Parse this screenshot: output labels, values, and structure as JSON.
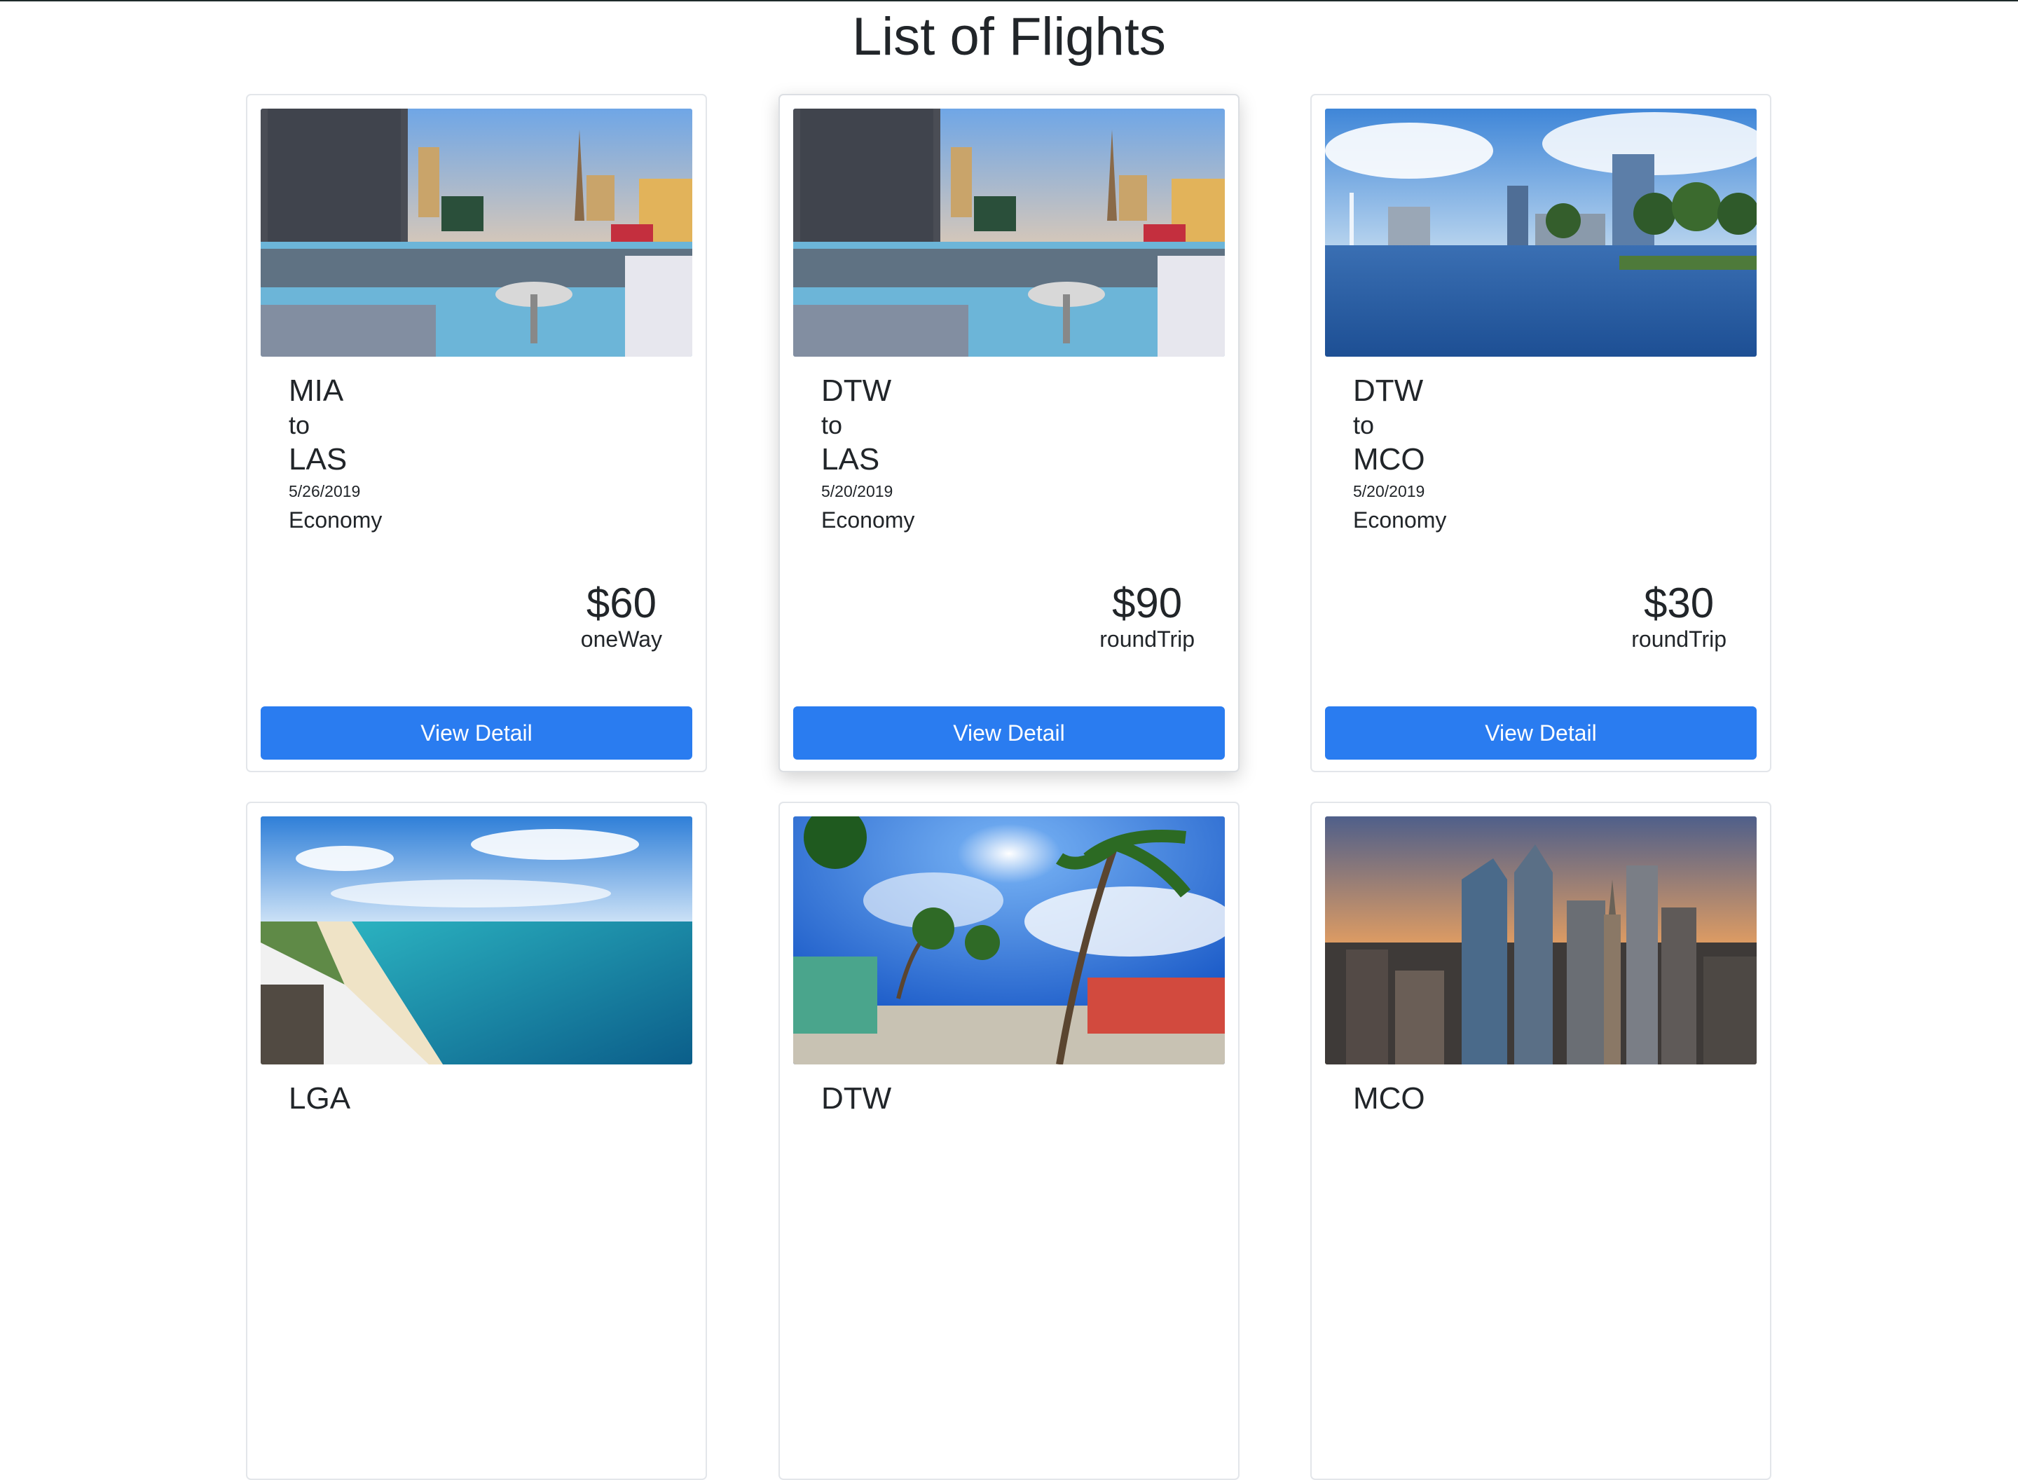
{
  "page": {
    "title": "List of Flights"
  },
  "flights": [
    {
      "image": "las-vegas-pool-photo",
      "origin": "MIA",
      "connector": "to",
      "destination": "LAS",
      "date": "5/26/2019",
      "cabin": "Economy",
      "price": "$60",
      "trip_type": "oneWay",
      "button_label": "View Detail"
    },
    {
      "image": "las-vegas-pool-photo",
      "origin": "DTW",
      "connector": "to",
      "destination": "LAS",
      "date": "5/20/2019",
      "cabin": "Economy",
      "price": "$90",
      "trip_type": "roundTrip",
      "button_label": "View Detail"
    },
    {
      "image": "orlando-lake-skyline-photo",
      "origin": "DTW",
      "connector": "to",
      "destination": "MCO",
      "date": "5/20/2019",
      "cabin": "Economy",
      "price": "$30",
      "trip_type": "roundTrip",
      "button_label": "View Detail"
    },
    {
      "image": "beach-coastline-photo",
      "origin": "LGA",
      "connector": "",
      "destination": "",
      "date": "",
      "cabin": "",
      "price": "",
      "trip_type": "",
      "button_label": ""
    },
    {
      "image": "tropical-palms-photo",
      "origin": "DTW",
      "connector": "",
      "destination": "",
      "date": "",
      "cabin": "",
      "price": "",
      "trip_type": "",
      "button_label": ""
    },
    {
      "image": "city-skyline-sunset-photo",
      "origin": "MCO",
      "connector": "",
      "destination": "",
      "date": "",
      "cabin": "",
      "price": "",
      "trip_type": "",
      "button_label": ""
    }
  ],
  "colors": {
    "button": "#2a7cf0",
    "text": "#212529",
    "card_border": "#e3e6ea"
  }
}
